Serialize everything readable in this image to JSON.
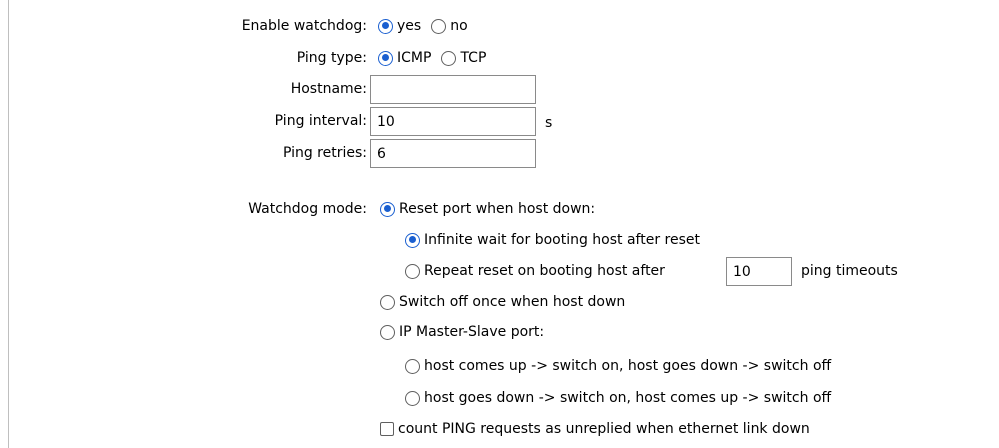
{
  "watchdog": {
    "enable_label": "Enable watchdog:",
    "enable_yes": "yes",
    "enable_no": "no",
    "ping_type_label": "Ping type:",
    "ping_icmp": "ICMP",
    "ping_tcp": "TCP",
    "hostname_label": "Hostname:",
    "hostname_value": "",
    "interval_label": "Ping interval:",
    "interval_value": "10",
    "interval_unit": "s",
    "retries_label": "Ping retries:",
    "retries_value": "6",
    "mode_label": "Watchdog mode:",
    "mode_reset": "Reset port when host down:",
    "mode_reset_infinite": "Infinite wait for booting host after reset",
    "mode_reset_repeat_prefix": "Repeat reset on booting host after",
    "mode_reset_repeat_value": "10",
    "mode_reset_repeat_suffix": "ping timeouts",
    "mode_switch_off": "Switch off once when host down",
    "mode_ip_master": "IP Master-Slave port:",
    "mode_ip_up_on": "host comes up -> switch on, host goes down -> switch off",
    "mode_ip_down_on": "host goes down -> switch on, host comes up -> switch off",
    "count_ping": "count PING requests as unreplied when ethernet link down"
  }
}
